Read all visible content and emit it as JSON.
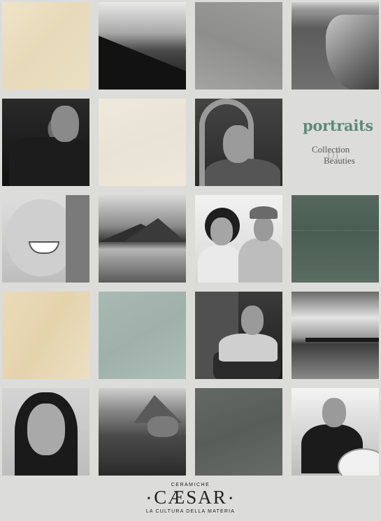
{
  "tiles": [
    {
      "name": "beige-stone-tile-1",
      "kind": "material"
    },
    {
      "name": "hikers-ridge-photo",
      "kind": "photo"
    },
    {
      "name": "grey-stone-tile",
      "kind": "material"
    },
    {
      "name": "coastal-cliffs-photo",
      "kind": "photo"
    },
    {
      "name": "bearded-man-portrait",
      "kind": "photo"
    },
    {
      "name": "cream-stone-tile",
      "kind": "material"
    },
    {
      "name": "curly-hair-man-portrait",
      "kind": "photo"
    },
    {
      "name": "portraits-text-tile",
      "kind": "text"
    },
    {
      "name": "smiling-woman-portrait",
      "kind": "photo"
    },
    {
      "name": "mountain-lake-photo",
      "kind": "photo"
    },
    {
      "name": "couple-portrait",
      "kind": "photo"
    },
    {
      "name": "green-stone-tile",
      "kind": "material"
    },
    {
      "name": "beige-stone-tile-2",
      "kind": "material"
    },
    {
      "name": "sage-stone-tile",
      "kind": "material"
    },
    {
      "name": "elderly-man-armchair-portrait",
      "kind": "photo"
    },
    {
      "name": "seascape-jetty-photo",
      "kind": "photo"
    },
    {
      "name": "dark-hair-woman-portrait",
      "kind": "photo"
    },
    {
      "name": "mountain-valley-photo",
      "kind": "photo"
    },
    {
      "name": "slate-stone-tile",
      "kind": "material"
    },
    {
      "name": "surfer-portrait",
      "kind": "photo"
    }
  ],
  "portraits": {
    "title": "portraits",
    "line1": "Collection",
    "of": "of",
    "line2": "Beauties",
    "title_color": "#5f8a78"
  },
  "logo": {
    "ceramiche": "CERAMICHE",
    "brand": "CÆSAR",
    "tagline": "LA CULTURA DELLA MATERIA"
  }
}
